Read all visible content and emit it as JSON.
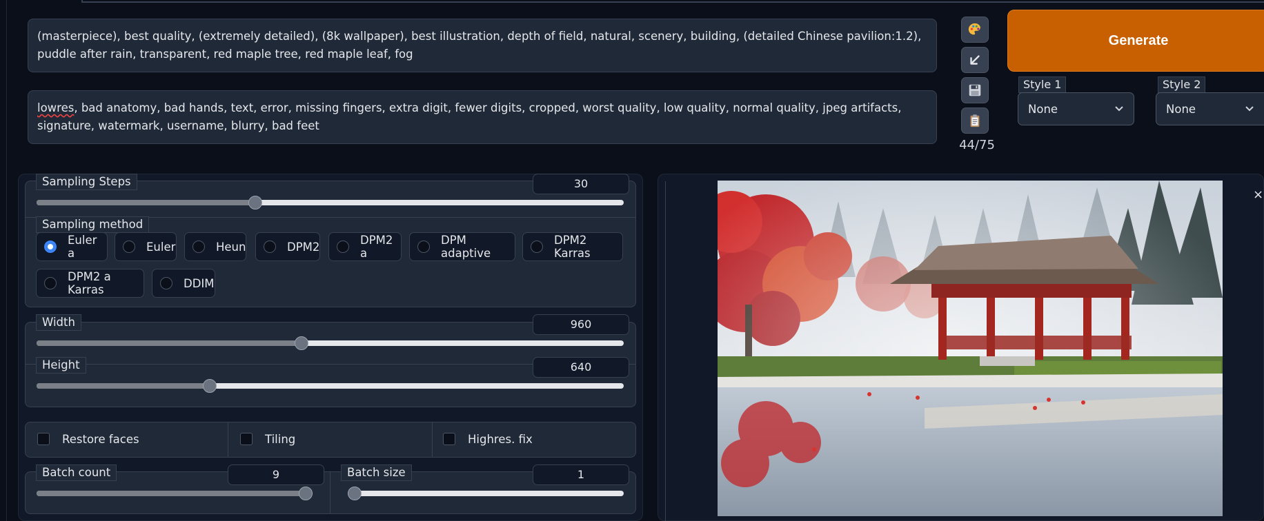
{
  "prompt": {
    "positive": "(masterpiece), best quality, (extremely detailed), (8k wallpaper), best illustration, depth of field, natural, scenery, building, (detailed Chinese pavilion:1.2), puddle after rain, transparent, red maple tree, red maple leaf, fog",
    "negative_first_word": "lowres",
    "negative_rest": ", bad anatomy, bad hands, text, error, missing fingers, extra digit, fewer digits, cropped, worst quality, low quality, normal quality, jpeg artifacts, signature, watermark, username, blurry, bad feet",
    "token_count": "44/75"
  },
  "toolbar": {
    "buttons": [
      "palette-icon",
      "arrow-down-left-icon",
      "save-icon",
      "clipboard-icon"
    ],
    "generate_label": "Generate",
    "generate_color": "#c85f00"
  },
  "styles": [
    {
      "label": "Style 1",
      "value": "None"
    },
    {
      "label": "Style 2",
      "value": "None"
    }
  ],
  "sampling": {
    "steps_label": "Sampling Steps",
    "steps_value": "30",
    "steps_fraction": 0.37,
    "method_label": "Sampling method",
    "methods": [
      "Euler a",
      "Euler",
      "Heun",
      "DPM2",
      "DPM2 a",
      "DPM adaptive",
      "DPM2 Karras",
      "DPM2 a Karras",
      "DDIM"
    ],
    "selected_method": "Euler a"
  },
  "size": {
    "width_label": "Width",
    "width_value": "960",
    "width_fraction": 0.45,
    "height_label": "Height",
    "height_value": "640",
    "height_fraction": 0.29
  },
  "options": {
    "restore_faces": "Restore faces",
    "tiling": "Tiling",
    "highres_fix": "Highres. fix"
  },
  "batch": {
    "count_label": "Batch count",
    "count_value": "9",
    "count_fraction": 1.0,
    "size_label": "Batch size",
    "size_value": "1",
    "size_fraction": 0.0
  },
  "gallery": {
    "close_symbol": "×"
  },
  "colors": {
    "accent_blue": "#3b82f6",
    "background": "#0b0f19",
    "surface": "#1f2937"
  }
}
